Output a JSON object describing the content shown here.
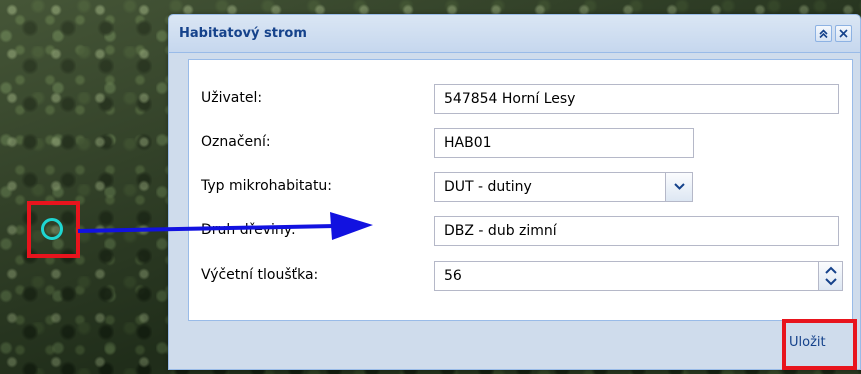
{
  "window": {
    "title": "Habitatový strom",
    "collapse_icon": "double-chevron-up-icon",
    "close_icon": "close-icon"
  },
  "form": {
    "fields": [
      {
        "label": "Uživatel:",
        "value": "547854 Horní Lesy"
      },
      {
        "label": "Označení:",
        "value": "HAB01"
      },
      {
        "label": "Typ mikrohabitatu:",
        "value": "DUT - dutiny"
      },
      {
        "label": "Druh dřeviny:",
        "value": "DBZ - dub zimní"
      },
      {
        "label": "Výčetní tloušťka:",
        "value": "56"
      }
    ]
  },
  "footer": {
    "save_label": "Uložit"
  },
  "annotations": {
    "highlight_color": "#e8141d",
    "marker_color": "#1fd6d2",
    "arrow_color": "#1212e0"
  },
  "colors": {
    "title_text": "#15428b",
    "window_bg": "#cfdcec",
    "border": "#99bbe8"
  }
}
